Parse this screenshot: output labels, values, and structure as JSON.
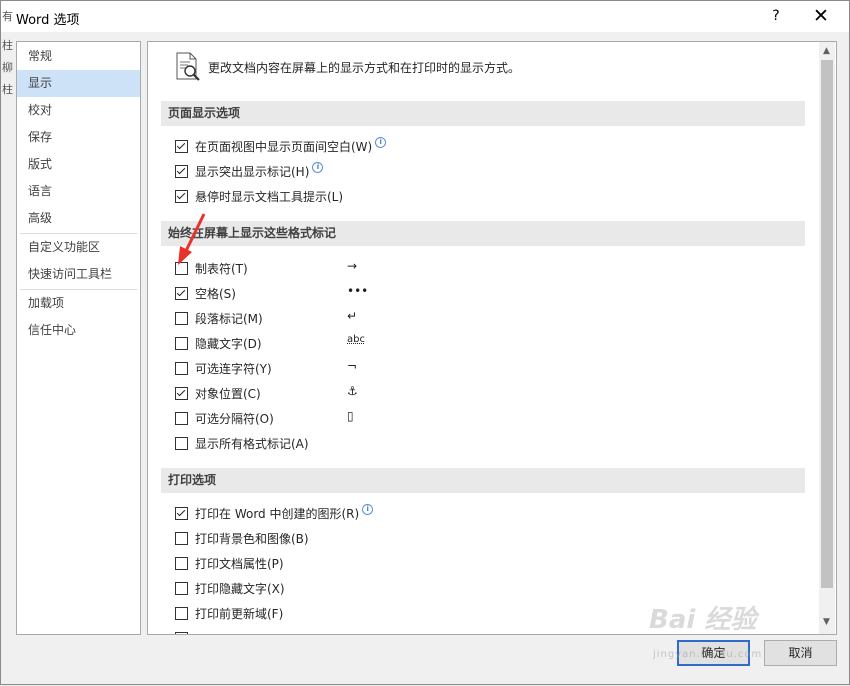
{
  "window": {
    "title": "Word 选项",
    "help": "?",
    "close": "✕"
  },
  "background_fragments": [
    "有",
    "柱",
    "柳",
    "柱"
  ],
  "nav": {
    "items": [
      {
        "label": "常规"
      },
      {
        "label": "显示",
        "selected": true
      },
      {
        "label": "校对"
      },
      {
        "label": "保存"
      },
      {
        "label": "版式"
      },
      {
        "label": "语言"
      },
      {
        "label": "高级"
      },
      {
        "label": "自定义功能区"
      },
      {
        "label": "快速访问工具栏"
      },
      {
        "label": "加载项"
      },
      {
        "label": "信任中心"
      }
    ]
  },
  "header": {
    "text": "更改文档内容在屏幕上的显示方式和在打印时的显示方式。"
  },
  "sections": {
    "page_display": "页面显示选项",
    "format_marks": "始终在屏幕上显示这些格式标记",
    "print": "打印选项"
  },
  "page_display_options": [
    {
      "label": "在页面视图中显示页面间空白(W)",
      "checked": true,
      "info": true
    },
    {
      "label": "显示突出显示标记(H)",
      "checked": true,
      "info": true
    },
    {
      "label": "悬停时显示文档工具提示(L)",
      "checked": true,
      "info": false
    }
  ],
  "format_mark_options": [
    {
      "label": "制表符(T)",
      "checked": false,
      "mark": "→"
    },
    {
      "label": "空格(S)",
      "checked": true,
      "mark": "•••"
    },
    {
      "label": "段落标记(M)",
      "checked": false,
      "mark": "↵"
    },
    {
      "label": "隐藏文字(D)",
      "checked": false,
      "mark": "abc"
    },
    {
      "label": "可选连字符(Y)",
      "checked": false,
      "mark": "¬"
    },
    {
      "label": "对象位置(C)",
      "checked": true,
      "mark": "⚓"
    },
    {
      "label": "可选分隔符(O)",
      "checked": false,
      "mark": "▯"
    },
    {
      "label": "显示所有格式标记(A)",
      "checked": false,
      "mark": ""
    }
  ],
  "print_options": [
    {
      "label": "打印在 Word 中创建的图形(R)",
      "checked": true,
      "info": true
    },
    {
      "label": "打印背景色和图像(B)",
      "checked": false,
      "info": false
    },
    {
      "label": "打印文档属性(P)",
      "checked": false,
      "info": false
    },
    {
      "label": "打印隐藏文字(X)",
      "checked": false,
      "info": false
    },
    {
      "label": "打印前更新域(F)",
      "checked": false,
      "info": false
    }
  ],
  "buttons": {
    "ok": "确定",
    "cancel": "取消"
  },
  "watermark": {
    "text": "Bai 经验",
    "sub": "jingyan.baidu.com"
  },
  "colors": {
    "selected_nav": "#cde1f7",
    "section_bg": "#e9e9e9",
    "ok_border": "#2f6bc9",
    "annotation_arrow": "#e8322b"
  }
}
